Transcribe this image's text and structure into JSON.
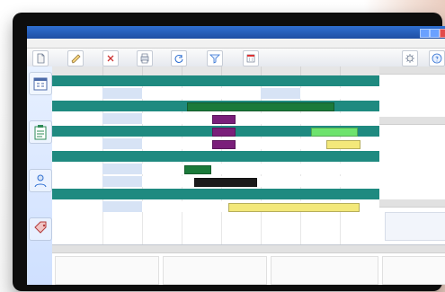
{
  "window": {
    "title": "",
    "menu_items": [
      "",
      "",
      "",
      "",
      "",
      "",
      "",
      "",
      "",
      ""
    ],
    "toolbar_labels": [
      "",
      "",
      "",
      "",
      "",
      "",
      "",
      "",
      ""
    ]
  },
  "sidebar": {
    "items": [
      {
        "label": ""
      },
      {
        "label": ""
      },
      {
        "label": ""
      },
      {
        "label": ""
      }
    ]
  },
  "gantt": {
    "rows": [
      {
        "label": ""
      },
      {
        "label": ""
      },
      {
        "label": ""
      },
      {
        "label": ""
      },
      {
        "label": ""
      },
      {
        "label": ""
      },
      {
        "label": ""
      },
      {
        "label": ""
      },
      {
        "label": ""
      },
      {
        "label": ""
      }
    ],
    "bars": [
      {
        "label": ""
      },
      {
        "label": ""
      },
      {
        "label": ""
      },
      {
        "label": ""
      },
      {
        "label": ""
      },
      {
        "label": ""
      }
    ]
  },
  "right_panel": {
    "sections": [
      {
        "title": ""
      },
      {
        "title": ""
      },
      {
        "title": ""
      }
    ]
  },
  "bottom": {
    "panels": [
      {
        "title": ""
      },
      {
        "title": ""
      },
      {
        "title": ""
      },
      {
        "title": ""
      }
    ]
  },
  "colors": {
    "teal": "#1f8a80",
    "green": "#1b7a3a",
    "purple": "#7a1f7a",
    "yellow": "#f3e87a",
    "light_green": "#6ee36e",
    "black": "#1a1a1a",
    "light_blue": "#d7e3f5"
  }
}
